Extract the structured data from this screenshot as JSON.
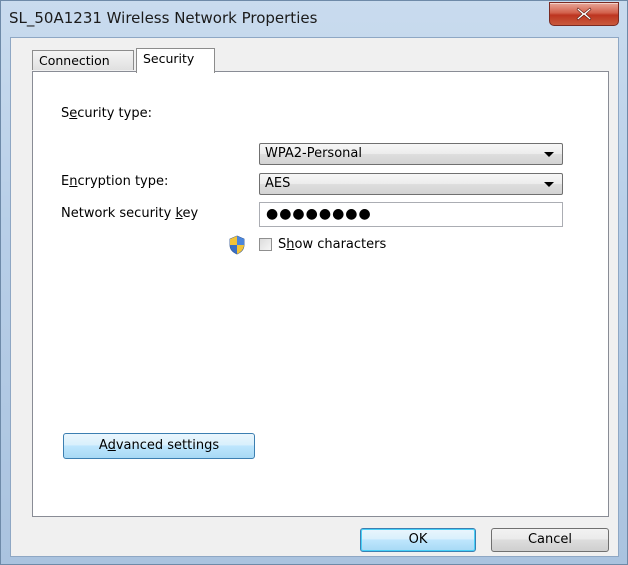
{
  "window": {
    "title": "SL_50A1231 Wireless Network Properties"
  },
  "tabs": [
    {
      "label": "Connection",
      "selected": false
    },
    {
      "label": "Security",
      "selected": true
    }
  ],
  "security": {
    "security_type": {
      "label_pre": "S",
      "label_accel": "e",
      "label_post": "curity type:",
      "value": "WPA2-Personal"
    },
    "encryption_type": {
      "label_pre": "E",
      "label_accel": "n",
      "label_post": "cryption type:",
      "value": "AES"
    },
    "network_key": {
      "label_pre": "Network security ",
      "label_accel": "k",
      "label_post": "ey",
      "masked_value": "●●●●●●●●"
    },
    "show_characters": {
      "label_pre": "S",
      "label_accel": "h",
      "label_post": "ow characters",
      "checked": false
    },
    "advanced_button": {
      "label_pre": "A",
      "label_accel": "d",
      "label_post": "vanced settings"
    }
  },
  "buttons": {
    "ok": "OK",
    "cancel": "Cancel"
  },
  "icons": {
    "close": "close-icon",
    "shield": "uac-shield-icon"
  },
  "colors": {
    "title_frame": "#b8cfe8",
    "close_button": "#c94a32",
    "default_button_border": "#3c7fb1"
  }
}
